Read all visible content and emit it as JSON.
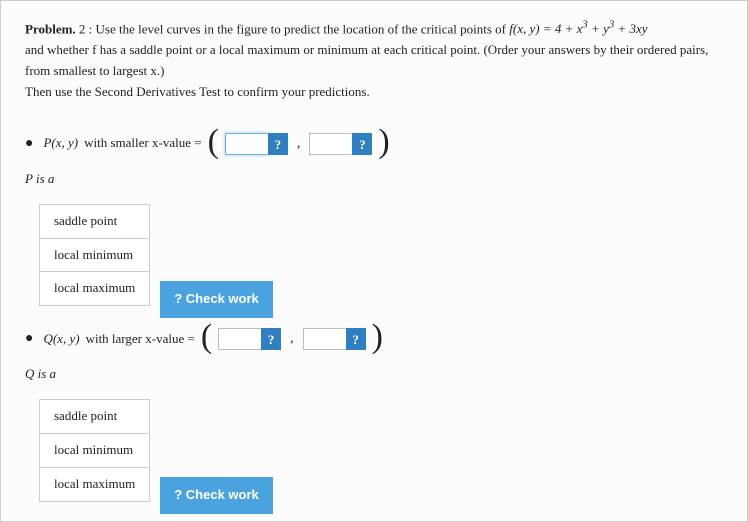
{
  "problem": {
    "label": "Problem.",
    "number": "2 :",
    "text1_pre": "Use the level curves in the figure to predict the location of the critical points of ",
    "func_lhs": "f(x, y) = 4 + x",
    "func_sup1": "3",
    "func_mid1": " + y",
    "func_sup2": "3",
    "func_mid2": " + 3xy",
    "text2": "and whether f has a saddle point or a local maximum or minimum at each critical point. (Order your answers by their ordered pairs, from smallest to largest x.)",
    "text3_a": "Then use the ",
    "text3_b": "Second Derivatives Test",
    "text3_c": " to confirm your predictions."
  },
  "pointP": {
    "bullet": "●",
    "label_pre": "P(x, y)",
    "label_post": " with smaller x-value = ",
    "classify": "P is a"
  },
  "pointQ": {
    "bullet": "●",
    "label_pre": "Q(x, y)",
    "label_post": " with larger x-value = ",
    "classify": "Q is a"
  },
  "options": {
    "opt1": "saddle point",
    "opt2": "local minimum",
    "opt3": "local maximum"
  },
  "buttons": {
    "qmark": "?",
    "check": "? Check work"
  }
}
